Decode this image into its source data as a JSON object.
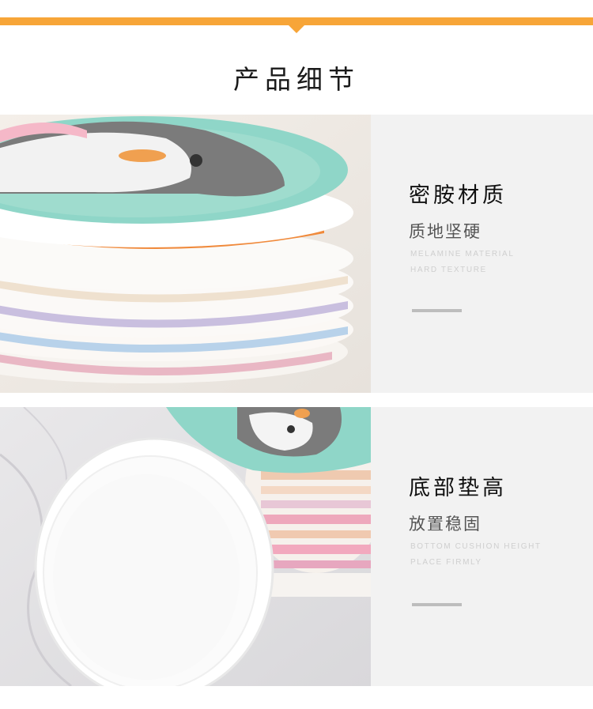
{
  "colors": {
    "accent": "#f7a538",
    "panel_bg": "#f2f2f2"
  },
  "header": {
    "title": "产品细节"
  },
  "features": [
    {
      "title": "密胺材质",
      "subtitle": "质地坚硬",
      "en_line1": "MELAMINE MATERIAL",
      "en_line2": "HARD TEXTURE"
    },
    {
      "title": "底部垫高",
      "subtitle": "放置稳固",
      "en_line1": "BOTTOM CUSHION HEIGHT",
      "en_line2": "PLACE FIRMLY"
    }
  ]
}
